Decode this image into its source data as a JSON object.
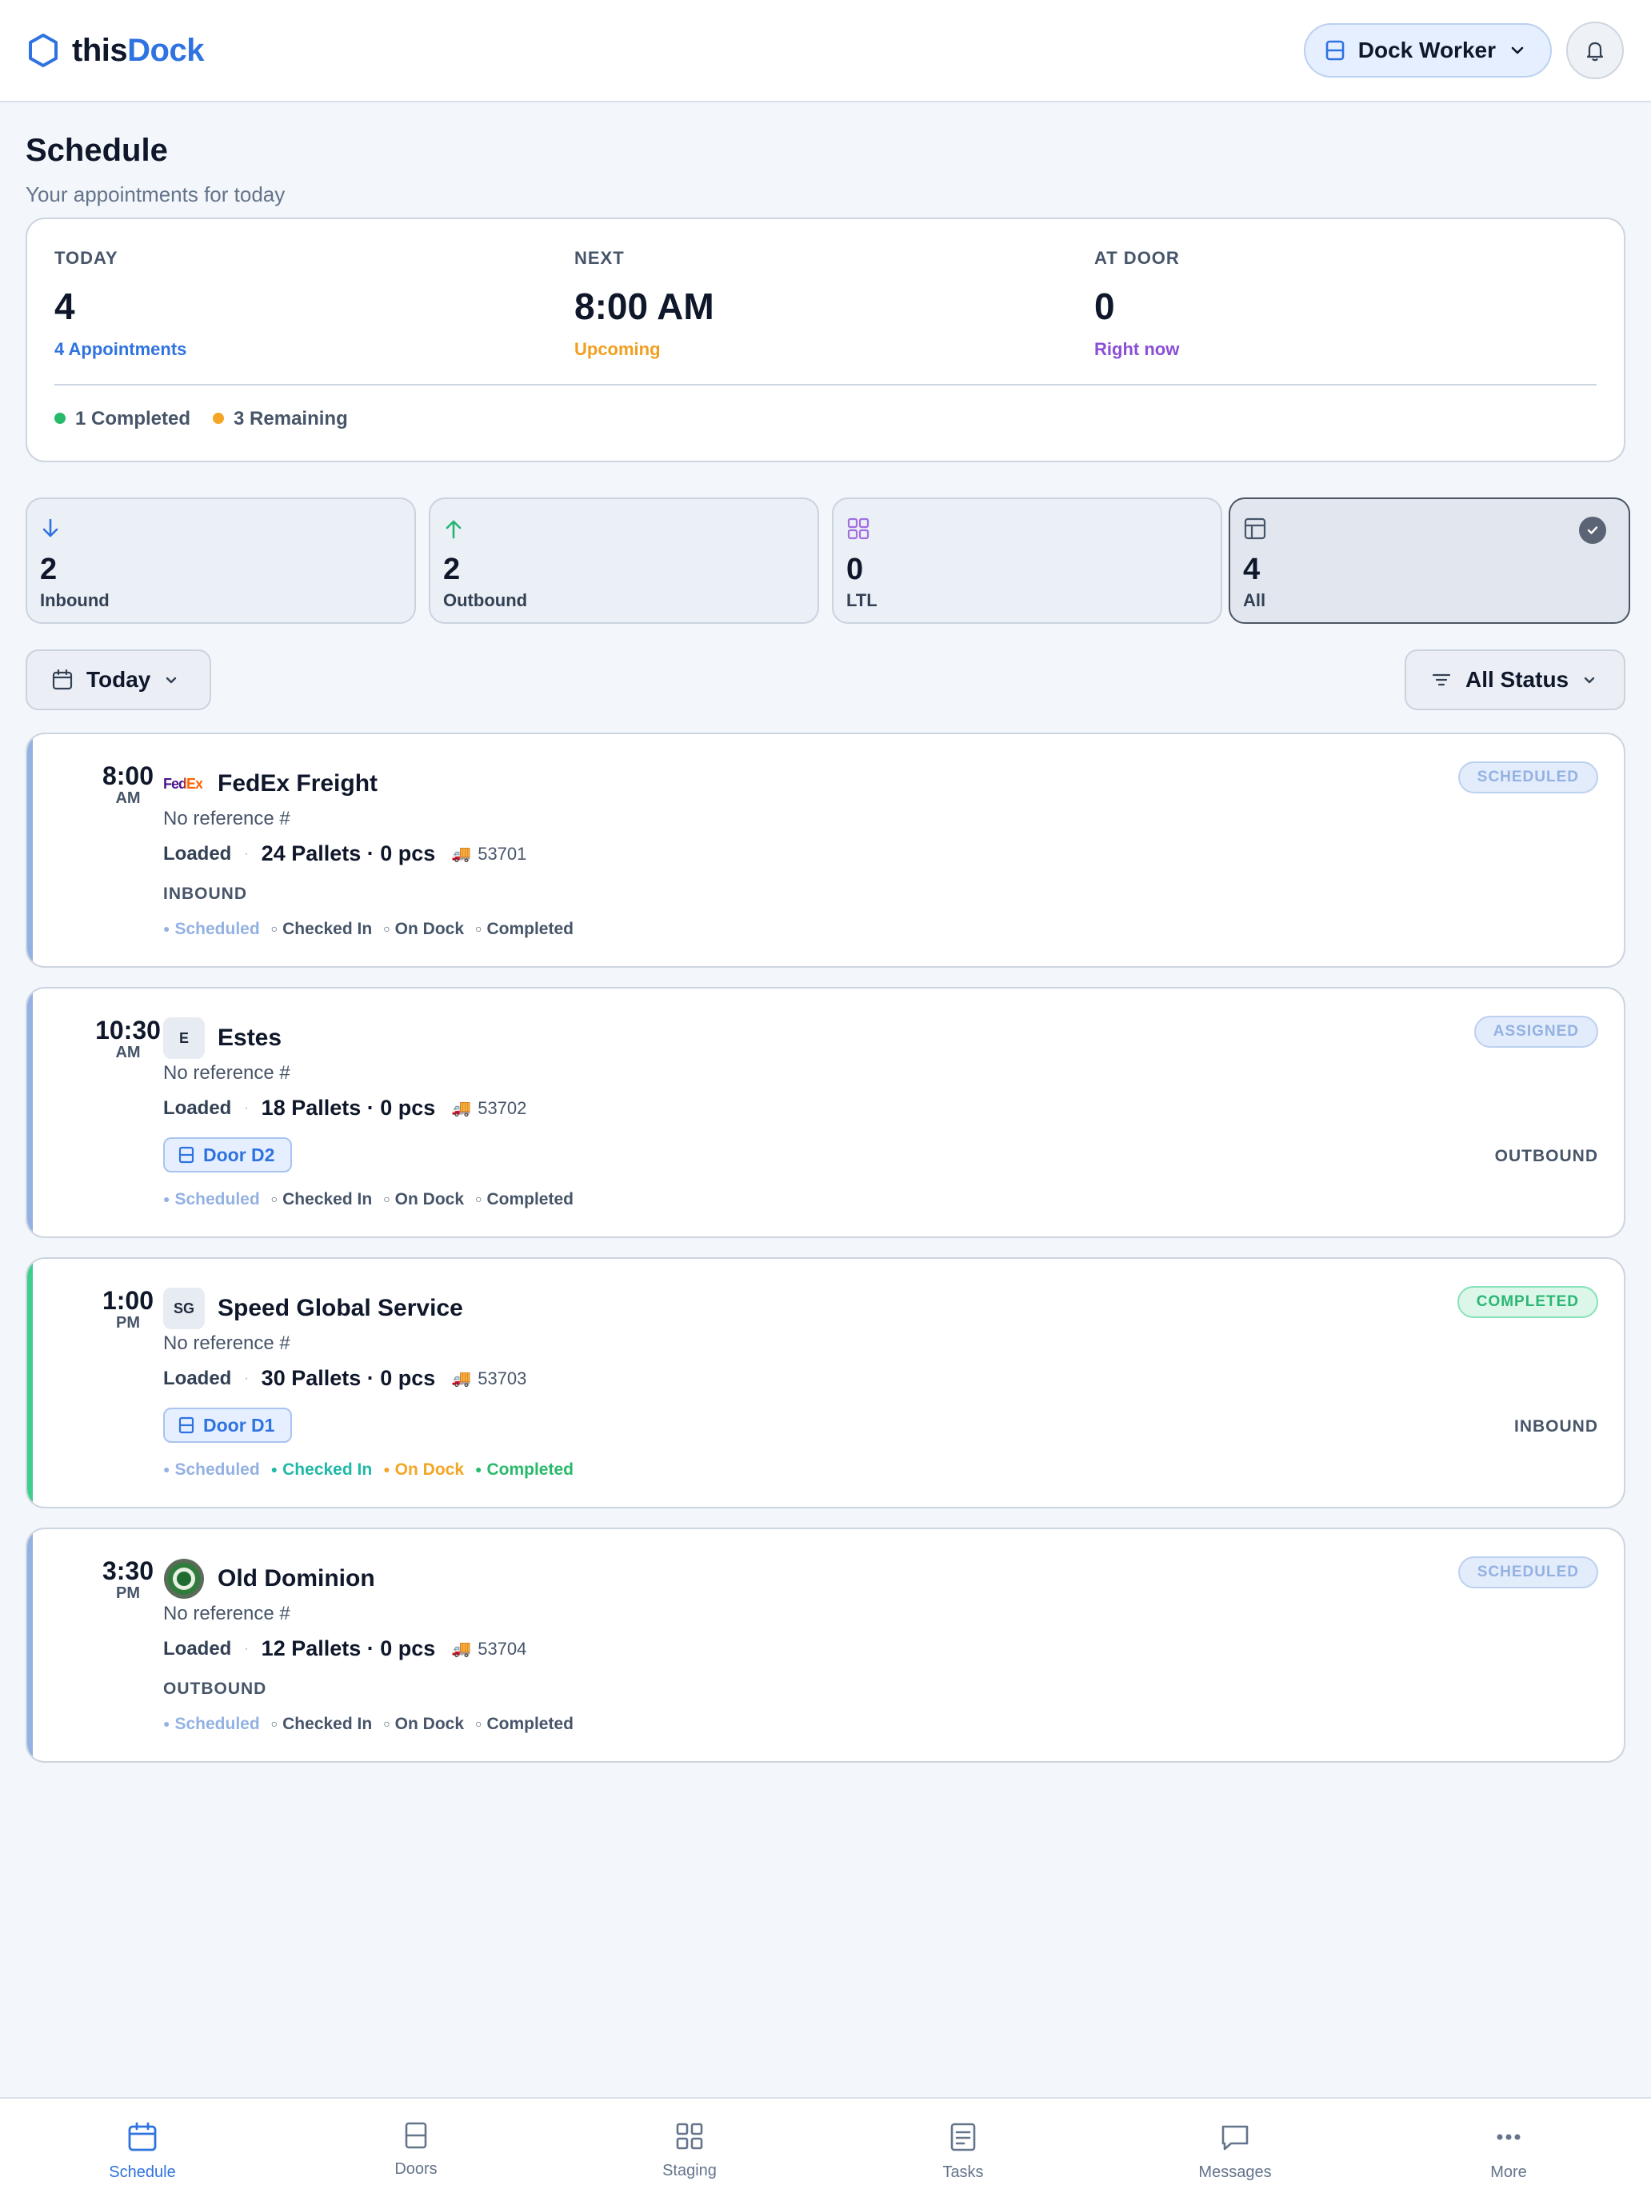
{
  "app": {
    "logo_part1": "this",
    "logo_part2": "Dock",
    "role_button": "Dock Worker"
  },
  "page": {
    "title": "Schedule",
    "subtitle": "Your appointments for today"
  },
  "summary": {
    "today": {
      "label": "TODAY",
      "value": "4",
      "sub": "4 Appointments"
    },
    "next": {
      "label": "NEXT",
      "value": "8:00 AM",
      "sub": "Upcoming"
    },
    "at_door": {
      "label": "AT DOOR",
      "value": "0",
      "sub": "Right now"
    },
    "completed": "1 Completed",
    "remaining": "3 Remaining"
  },
  "type_filters": [
    {
      "count": "2",
      "label": "Inbound",
      "icon": "arrow-down-icon"
    },
    {
      "count": "2",
      "label": "Outbound",
      "icon": "arrow-up-icon"
    },
    {
      "count": "0",
      "label": "LTL",
      "icon": "grid-icon"
    },
    {
      "count": "4",
      "label": "All",
      "icon": "layout-icon",
      "selected": true
    }
  ],
  "controls": {
    "date": "Today",
    "status": "All Status"
  },
  "appointments": [
    {
      "time": "8:00",
      "ampm": "AM",
      "carrier": "FedEx Freight",
      "logo_text": "FedEx",
      "reference": "No reference #",
      "load_label": "Loaded",
      "quantity": "24 Pallets · 0 pcs",
      "number": "53701",
      "direction": "INBOUND",
      "status": "SCHEDULED"
    },
    {
      "time": "10:30",
      "ampm": "AM",
      "carrier": "Estes",
      "logo_text": "E",
      "reference": "No reference #",
      "load_label": "Loaded",
      "quantity": "18 Pallets · 0 pcs",
      "number": "53702",
      "direction": "OUTBOUND",
      "status": "ASSIGNED",
      "door": "Door D2"
    },
    {
      "time": "1:00",
      "ampm": "PM",
      "carrier": "Speed Global Service",
      "logo_text": "SG",
      "reference": "No reference #",
      "load_label": "Loaded",
      "quantity": "30 Pallets · 0 pcs",
      "number": "53703",
      "direction": "INBOUND",
      "status": "COMPLETED",
      "door": "Door D1"
    },
    {
      "time": "3:30",
      "ampm": "PM",
      "carrier": "Old Dominion",
      "logo_text": "",
      "reference": "No reference #",
      "load_label": "Loaded",
      "quantity": "12 Pallets · 0 pcs",
      "number": "53704",
      "direction": "OUTBOUND",
      "status": "SCHEDULED"
    }
  ],
  "progress_steps": [
    "Scheduled",
    "Checked In",
    "On Dock",
    "Completed"
  ],
  "nav": {
    "schedule": "Schedule",
    "doors": "Doors",
    "staging": "Staging",
    "tasks": "Tasks",
    "messages": "Messages",
    "more": "More"
  },
  "colors": {
    "brand": "#2f73e0",
    "scheduled": "#93b1e3",
    "completed": "#29b96b",
    "remaining": "#f5a524",
    "at_door": "#8b4fd6"
  }
}
